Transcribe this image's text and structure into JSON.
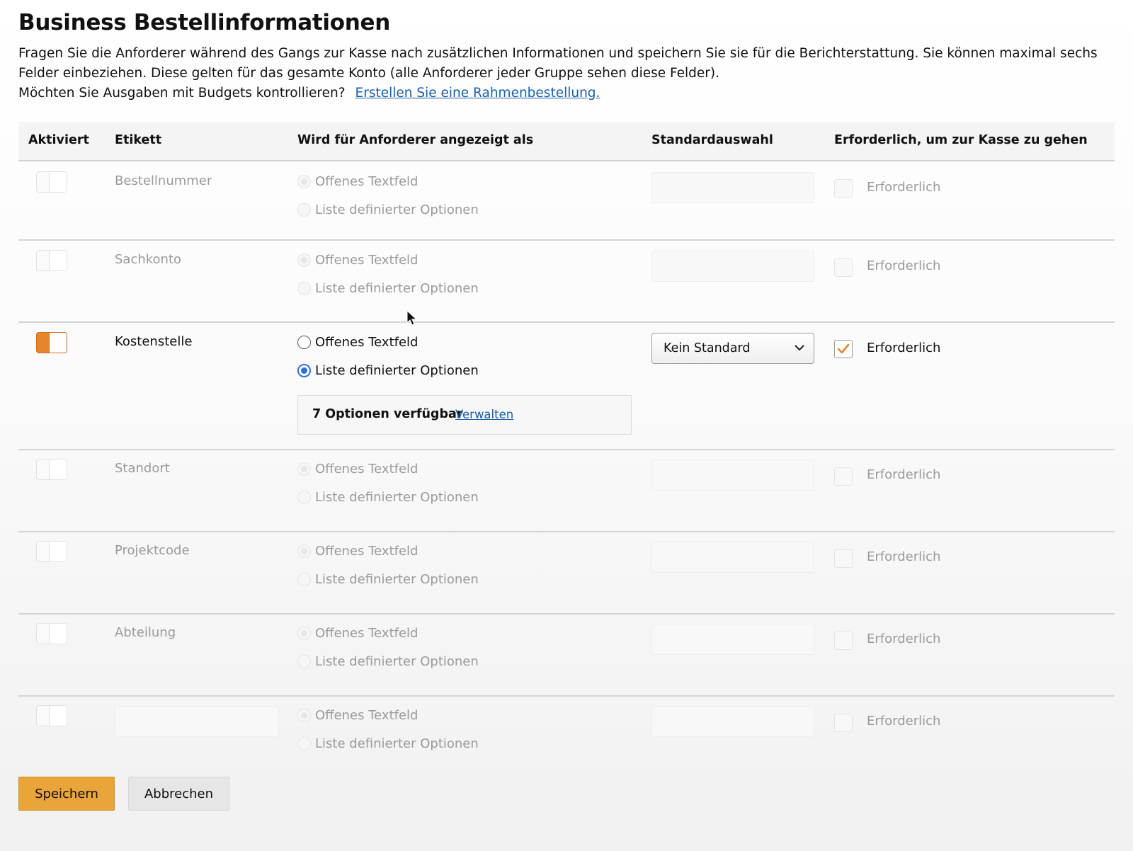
{
  "header": {
    "title": "Business Bestellinformationen",
    "description": "Fragen Sie die Anforderer während des Gangs zur Kasse nach zusätzlichen Informationen und speichern Sie sie für die Berichterstattung. Sie können maximal sechs Felder einbeziehen. Diese gelten für das gesamte Konto (alle Anforderer jeder Gruppe sehen diese Felder).",
    "budget_question": "Möchten Sie Ausgaben mit Budgets kontrollieren?",
    "budget_link": "Erstellen Sie eine Rahmenbestellung."
  },
  "table": {
    "columns": {
      "enabled": "Aktiviert",
      "label": "Etikett",
      "displayed_as": "Wird für Anforderer angezeigt als",
      "default": "Standardauswahl",
      "required": "Erforderlich, um zur Kasse zu gehen"
    },
    "radio_open": "Offenes Textfeld",
    "radio_list": "Liste definierter Optionen",
    "required_label": "Erforderlich",
    "rows": [
      {
        "label": "Bestellnummer",
        "enabled": false,
        "required": false
      },
      {
        "label": "Sachkonto",
        "enabled": false,
        "required": false
      },
      {
        "label": "Kostenstelle",
        "enabled": true,
        "required": true,
        "display_mode": "Liste definierter Optionen",
        "default_value": "Kein Standard",
        "options_count": "7 Optionen verfügbar",
        "options_manage": "Verwalten"
      },
      {
        "label": "Standort",
        "enabled": false,
        "required": false
      },
      {
        "label": "Projektcode",
        "enabled": false,
        "required": false
      },
      {
        "label": "Abteilung",
        "enabled": false,
        "required": false
      },
      {
        "label": "",
        "enabled": false,
        "required": false
      }
    ]
  },
  "actions": {
    "save": "Speichern",
    "cancel": "Abbrechen"
  },
  "colors": {
    "toggle_on": "#e5852e",
    "radio_selected": "#2f6fd8",
    "link": "#1a5fa8",
    "primary_button": "#e8a53a"
  }
}
